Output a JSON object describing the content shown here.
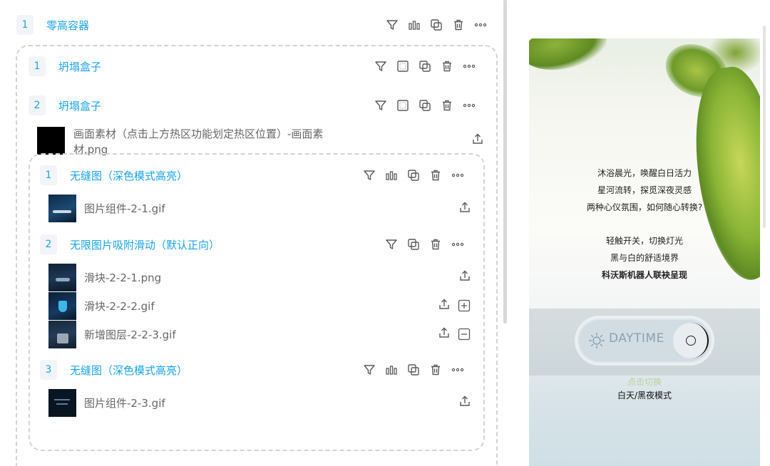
{
  "root": {
    "index": "1",
    "title": "零高容器"
  },
  "box1": {
    "index": "1",
    "title": "坍塌盒子"
  },
  "box2": {
    "index": "2",
    "title": "坍塌盒子",
    "asset_name_line1": "画面素材（点击上方热区功能划定热区位置）-画面素",
    "asset_name_line2": "材.png"
  },
  "inner": {
    "items": [
      {
        "index": "1",
        "title": "无缝图（深色模式高亮）",
        "asset": "图片组件-2-1.gif"
      },
      {
        "index": "2",
        "title": "无限图片吸附滑动（默认正向）",
        "assets": [
          "滑块-2-2-1.png",
          "滑块-2-2-2.gif",
          "新增图层-2-2-3.gif"
        ]
      },
      {
        "index": "3",
        "title": "无缝图（深色模式高亮）",
        "asset": "图片组件-2-3.gif"
      }
    ]
  },
  "preview": {
    "poem": [
      "沐浴晨光，唤醒白日活力",
      "星河流转，探觅深夜灵感",
      "两种心仪氛围，如何随心转换?",
      "轻触开关，切换灯光",
      "黑与白的舒适境界",
      "科沃斯机器人联袂呈现"
    ],
    "switch_label": "DAYTIME",
    "caption1": "点击切换",
    "caption2": "白天/黑夜模式"
  },
  "icons": [
    "filter-icon",
    "bar-chart-icon",
    "copy-icon",
    "trash-icon",
    "more-icon",
    "grid-icon",
    "upload-icon",
    "plus-icon",
    "minus-icon",
    "sun-icon"
  ],
  "colors": {
    "accent": "#1aa3e8",
    "icon": "#5a5a5a",
    "dash": "#d3d3d3"
  }
}
